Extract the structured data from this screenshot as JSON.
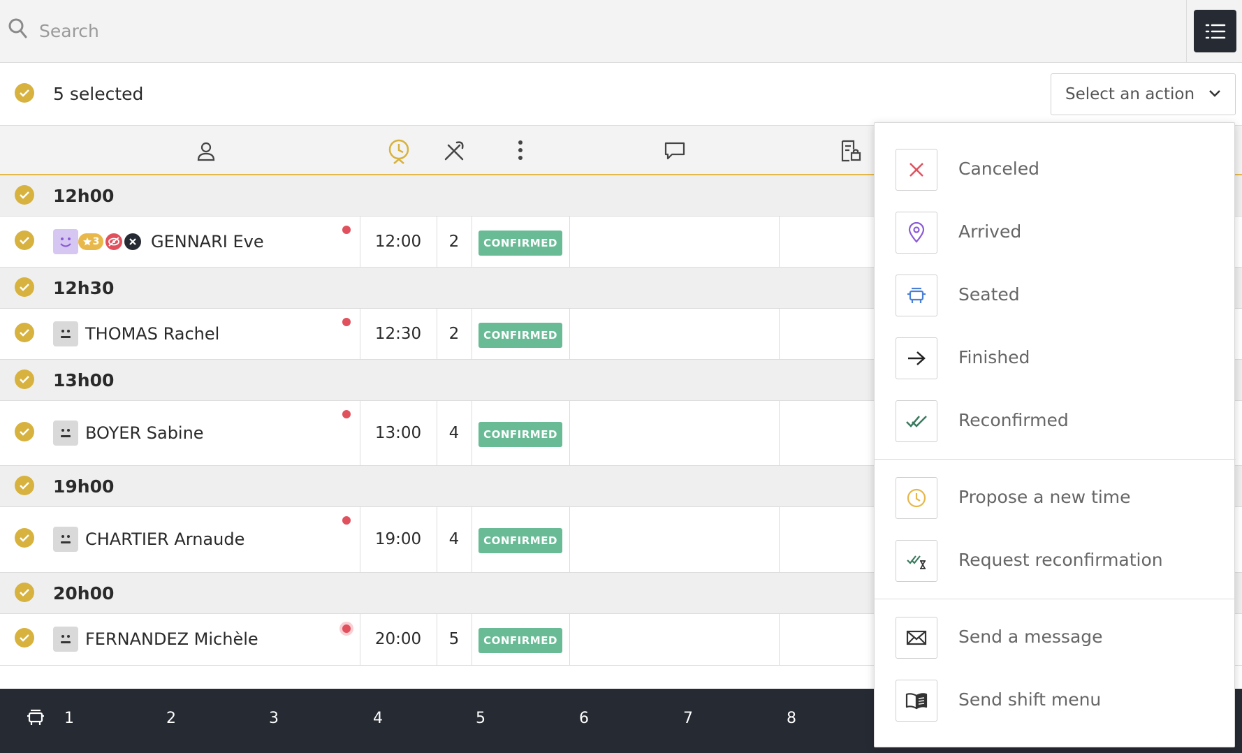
{
  "search": {
    "placeholder": "Search"
  },
  "selection": {
    "text": "5 selected",
    "action_placeholder": "Select an action"
  },
  "groups": [
    {
      "label": "12h00",
      "rows": [
        {
          "name": "GENNARI Eve",
          "time": "12:00",
          "pax": "2",
          "status": "CONFIRMED",
          "tag": "3"
        }
      ]
    },
    {
      "label": "12h30",
      "rows": [
        {
          "name": "THOMAS Rachel",
          "time": "12:30",
          "pax": "2",
          "status": "CONFIRMED"
        }
      ]
    },
    {
      "label": "13h00",
      "rows": [
        {
          "name": "BOYER Sabine",
          "time": "13:00",
          "pax": "4",
          "status": "CONFIRMED"
        }
      ]
    },
    {
      "label": "19h00",
      "rows": [
        {
          "name": "CHARTIER Arnaude",
          "time": "19:00",
          "pax": "4",
          "status": "CONFIRMED"
        }
      ]
    },
    {
      "label": "20h00",
      "rows": [
        {
          "name": "FERNANDEZ Michèle",
          "time": "20:00",
          "pax": "5",
          "status": "CONFIRMED"
        }
      ]
    }
  ],
  "actions": [
    {
      "label": "Canceled",
      "icon": "close-icon"
    },
    {
      "label": "Arrived",
      "icon": "location-pin-icon"
    },
    {
      "label": "Seated",
      "icon": "seat-icon"
    },
    {
      "label": "Finished",
      "icon": "arrow-right-icon"
    },
    {
      "label": "Reconfirmed",
      "icon": "double-check-icon"
    },
    {
      "label": "Propose a new time",
      "icon": "clock-icon"
    },
    {
      "label": "Request reconfirmation",
      "icon": "check-hourglass-icon"
    },
    {
      "label": "Send a message",
      "icon": "envelope-icon"
    },
    {
      "label": "Send shift menu",
      "icon": "book-icon"
    }
  ],
  "footer": {
    "pages": [
      "1",
      "2",
      "3",
      "4",
      "5",
      "6",
      "7",
      "8"
    ]
  },
  "colors": {
    "accent": "#d7b23f",
    "confirmed": "#69bb96",
    "dark": "#262a33",
    "alert": "#e0515d"
  }
}
